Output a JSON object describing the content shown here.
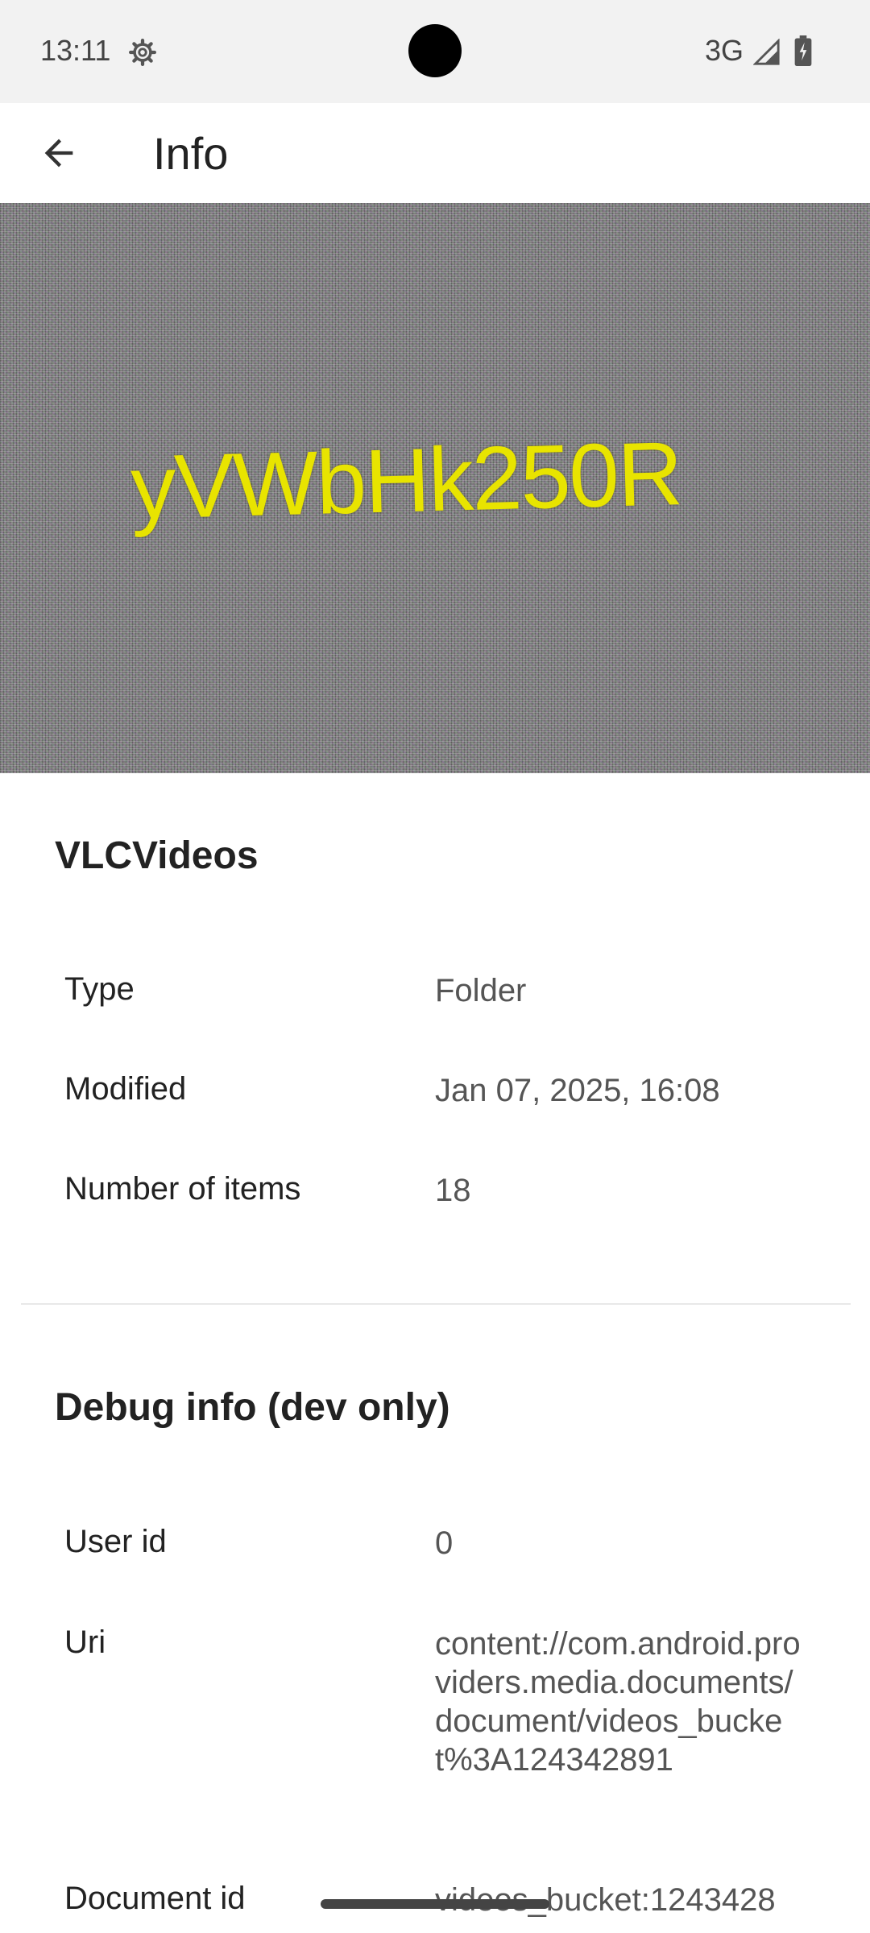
{
  "status_bar": {
    "time": "13:11",
    "network": "3G",
    "icons": [
      "gear-icon",
      "signal-icon",
      "battery-icon"
    ]
  },
  "app_bar": {
    "title": "Info",
    "back_icon": "arrow-back-icon"
  },
  "hero": {
    "text": "yVWbHk250R"
  },
  "folder": {
    "name": "VLCVideos",
    "rows": [
      {
        "label": "Type",
        "value": "Folder"
      },
      {
        "label": "Modified",
        "value": "Jan 07, 2025, 16:08"
      },
      {
        "label": "Number of items",
        "value": "18"
      }
    ]
  },
  "debug": {
    "title": "Debug info (dev only)",
    "rows": [
      {
        "label": "User id",
        "value": "0"
      },
      {
        "label": "Uri",
        "value": "content://com.android.providers.media.documents/document/videos_bucket%3A124342891"
      },
      {
        "label": "Document id",
        "value": "videos_bucket:1243428"
      }
    ]
  },
  "colors": {
    "background": "#ffffff",
    "status_bar": "#f2f2f2",
    "hero_text": "#e8e400",
    "label_text": "#222222",
    "value_text": "#555555"
  }
}
